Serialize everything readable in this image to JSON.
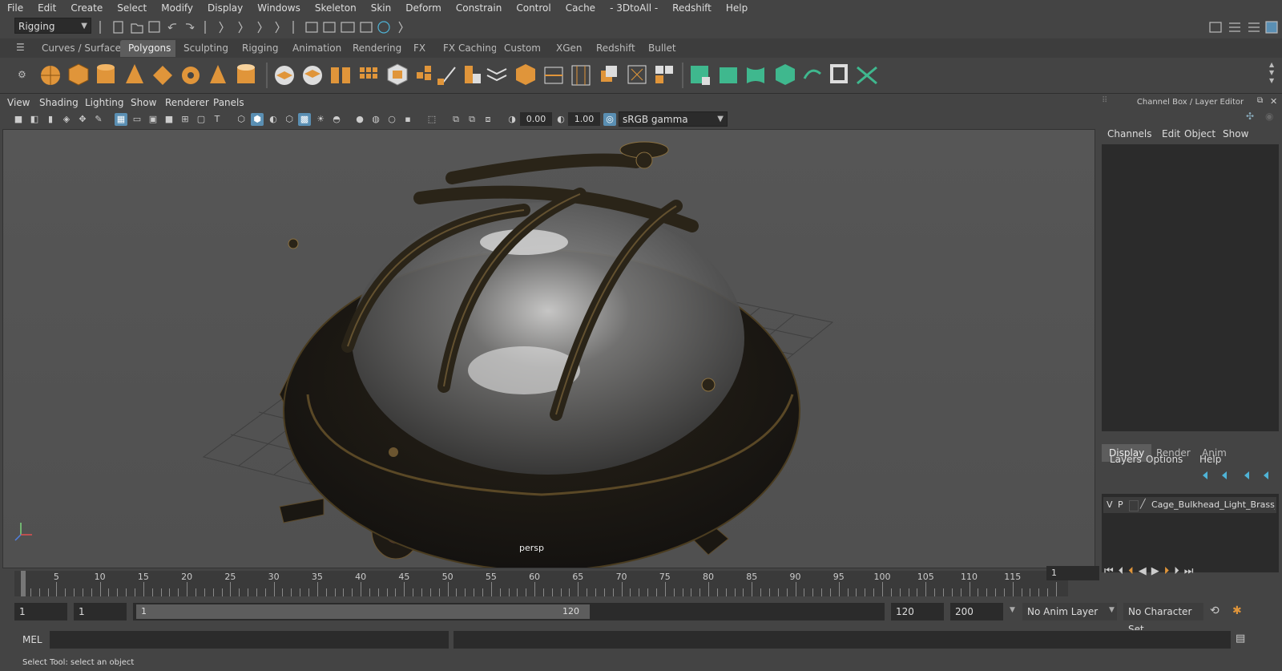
{
  "menubar": {
    "items": [
      "File",
      "Edit",
      "Create",
      "Select",
      "Modify",
      "Display",
      "Windows",
      "Skeleton",
      "Skin",
      "Deform",
      "Constrain",
      "Control",
      "Cache",
      "- 3DtoAll -",
      "Redshift",
      "Help"
    ]
  },
  "statusline": {
    "menuset": "Rigging"
  },
  "shelf": {
    "tabs": [
      "Curves / Surfaces",
      "Polygons",
      "Sculpting",
      "Rigging",
      "Animation",
      "Rendering",
      "FX",
      "FX Caching",
      "Custom",
      "XGen",
      "Redshift",
      "Bullet"
    ],
    "active_tab": "Polygons"
  },
  "viewport": {
    "menus": [
      "View",
      "Shading",
      "Lighting",
      "Show",
      "Renderer",
      "Panels"
    ],
    "exposure": "0.00",
    "gamma": "1.00",
    "color_space": "sRGB gamma",
    "camera_label": "persp"
  },
  "channel_box": {
    "title": "Channel Box / Layer Editor",
    "menus": [
      "Channels",
      "Edit",
      "Object",
      "Show"
    ],
    "display_tabs": [
      "Display",
      "Render",
      "Anim"
    ],
    "active_display_tab": "Display",
    "layer_menus": [
      "Layers",
      "Options",
      "Help"
    ],
    "layer": {
      "v": "V",
      "p": "P",
      "name": "Cage_Bulkhead_Light_Brass_wi"
    }
  },
  "timeline": {
    "labels": [
      "1",
      "5",
      "10",
      "15",
      "20",
      "25",
      "30",
      "35",
      "40",
      "45",
      "50",
      "55",
      "60",
      "65",
      "70",
      "75",
      "80",
      "85",
      "90",
      "95",
      "100",
      "105",
      "110",
      "115",
      "120"
    ],
    "current_frame": "1"
  },
  "range": {
    "start": "1",
    "playback_start": "1",
    "slider_start": "1",
    "slider_end": "120",
    "playback_end": "120",
    "end": "200",
    "anim_layer": "No Anim Layer",
    "character_set": "No Character Set"
  },
  "command": {
    "label": "MEL"
  },
  "help": {
    "text": "Select Tool: select an object"
  },
  "colors": {
    "accent": "#5a8fb3",
    "shelf_orange": "#e0953a",
    "shelf_green": "#3fb88e"
  }
}
